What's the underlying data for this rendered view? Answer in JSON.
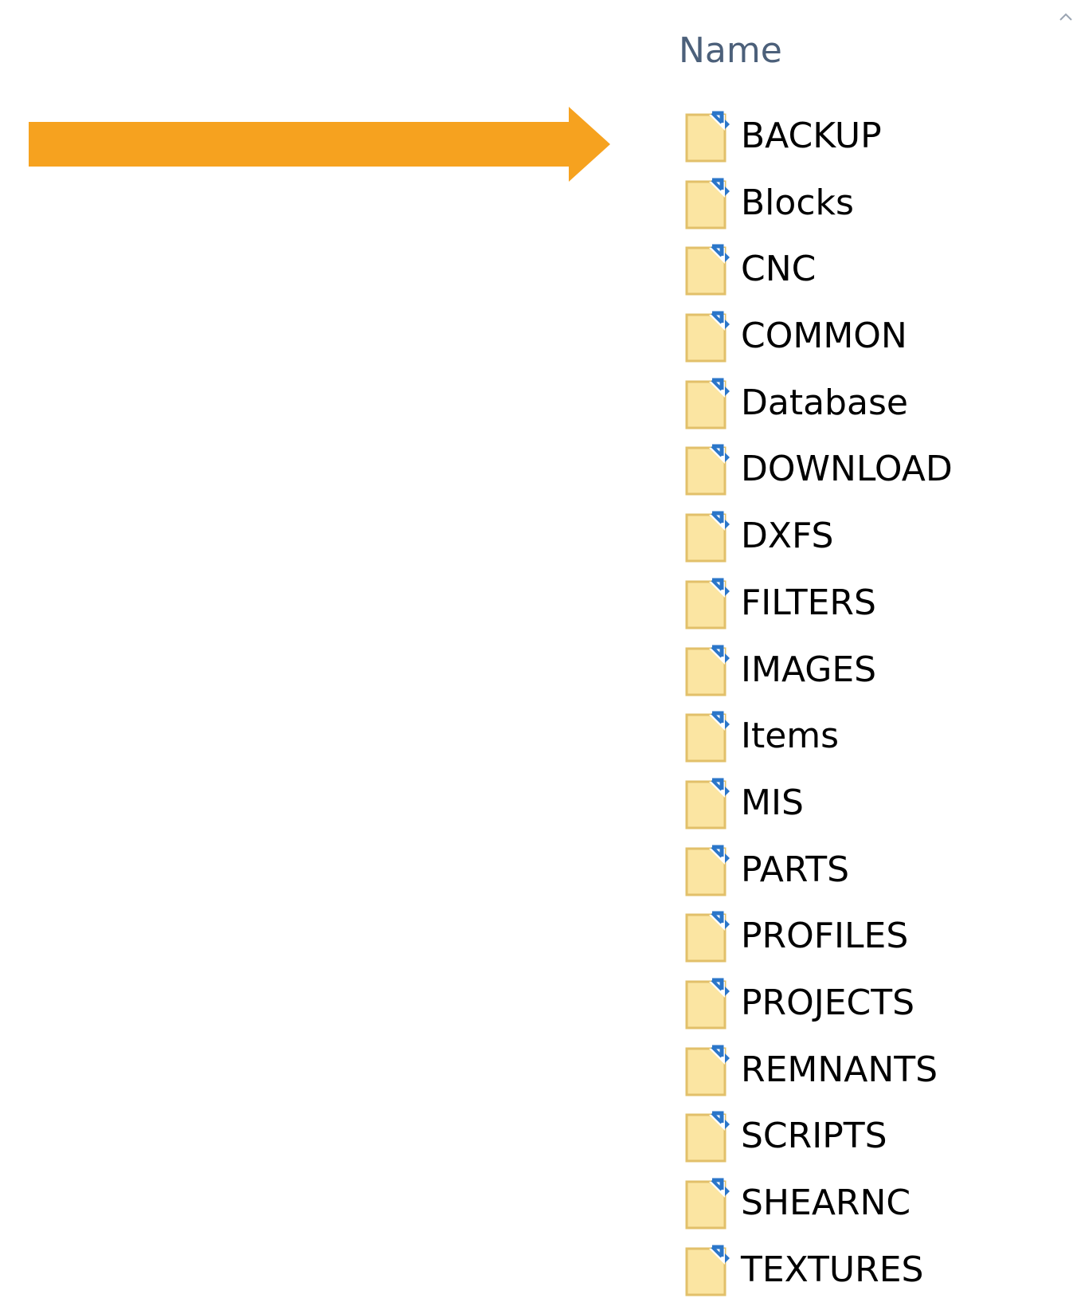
{
  "colors": {
    "arrow": "#f6a21f",
    "header_text": "#4c607a",
    "folder_fill": "#fbe5a2",
    "folder_edge": "#e2c06a",
    "shortcut_mark": "#2b76c9"
  },
  "column_header": {
    "name_label": "Name",
    "sort_indicator_icon": "sort-caret-icon"
  },
  "pointer": {
    "icon": "arrow-right-icon",
    "points_to": "BACKUP"
  },
  "items": [
    {
      "name": "BACKUP"
    },
    {
      "name": "Blocks"
    },
    {
      "name": "CNC"
    },
    {
      "name": "COMMON"
    },
    {
      "name": "Database"
    },
    {
      "name": "DOWNLOAD"
    },
    {
      "name": "DXFS"
    },
    {
      "name": "FILTERS"
    },
    {
      "name": "IMAGES"
    },
    {
      "name": "Items"
    },
    {
      "name": "MIS"
    },
    {
      "name": "PARTS"
    },
    {
      "name": "PROFILES"
    },
    {
      "name": "PROJECTS"
    },
    {
      "name": "REMNANTS"
    },
    {
      "name": "SCRIPTS"
    },
    {
      "name": "SHEARNC"
    },
    {
      "name": "TEXTURES"
    }
  ]
}
